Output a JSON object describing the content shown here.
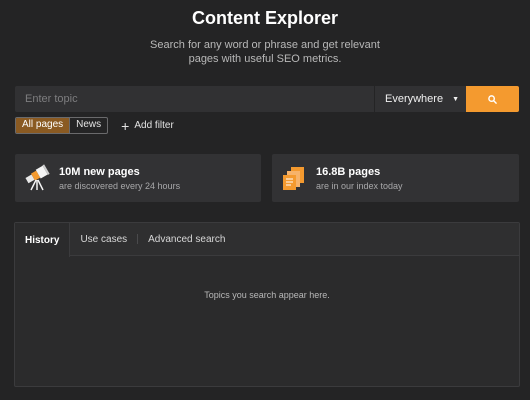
{
  "header": {
    "title": "Content Explorer",
    "subtitle_line1": "Search for any word or phrase and get relevant",
    "subtitle_line2": "pages with useful SEO metrics."
  },
  "search": {
    "placeholder": "Enter topic",
    "value": "",
    "scope_selected": "Everywhere",
    "button_icon": "search-icon"
  },
  "filters": {
    "segments": [
      "All pages",
      "News"
    ],
    "active_segment": "All pages",
    "add_filter_label": "Add filter"
  },
  "stats": [
    {
      "icon": "telescope-icon",
      "value": "10M new pages",
      "desc": "are discovered every 24 hours"
    },
    {
      "icon": "pages-stack-icon",
      "value": "16.8B pages",
      "desc": "are in our index today"
    }
  ],
  "panel": {
    "tabs": [
      "History",
      "Use cases",
      "Advanced search"
    ],
    "active_tab": "History",
    "empty_message": "Topics you search appear here."
  },
  "colors": {
    "background": "#242425",
    "accent": "#f49a2f",
    "active_segment": "#8a5a22"
  }
}
